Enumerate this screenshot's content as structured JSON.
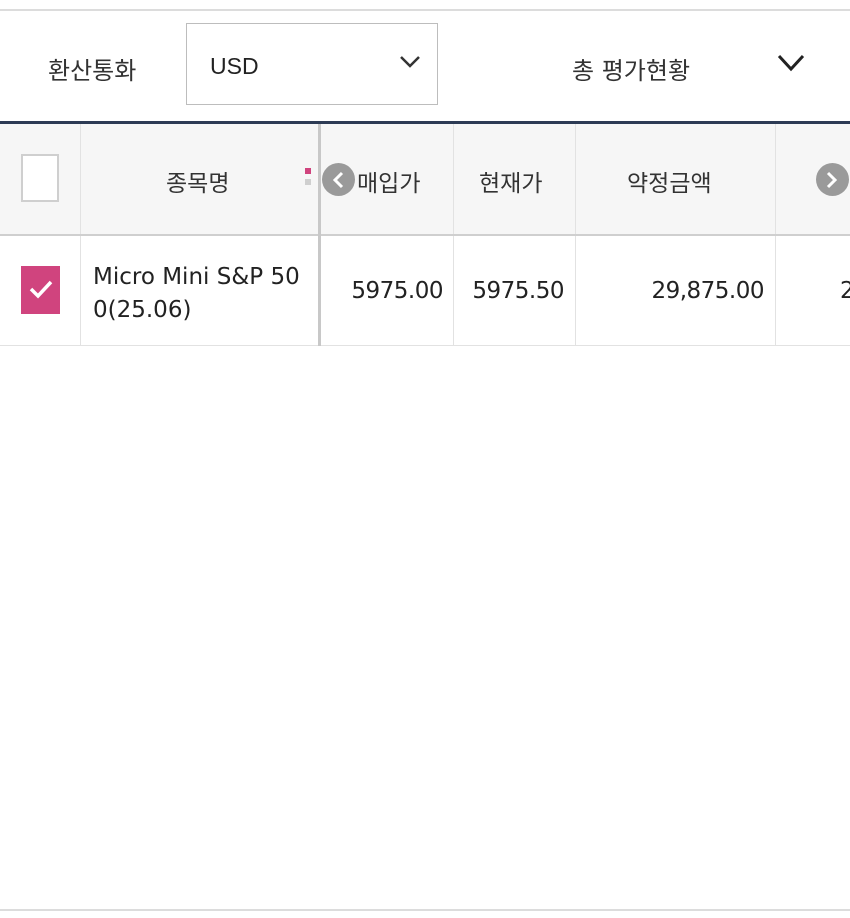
{
  "filter": {
    "currency_label": "환산통화",
    "currency_value": "USD",
    "summary_label": "총 평가현황"
  },
  "table": {
    "columns": [
      "종목명",
      "매입가",
      "현재가",
      "약정금액"
    ],
    "rows": [
      {
        "checked": true,
        "name": "Micro Mini S&P 500(25.06)",
        "buy_price": "5975.00",
        "current_price": "5975.50",
        "contract_amount": "29,875.00",
        "next_partial": "2"
      }
    ]
  },
  "colors": {
    "accent": "#d0447e",
    "header_rule": "#2d3b55",
    "nav_button": "#9a9a9a"
  },
  "icons": [
    "chevron-down-icon",
    "chevron-left-icon",
    "chevron-right-icon",
    "checkmark-icon"
  ]
}
